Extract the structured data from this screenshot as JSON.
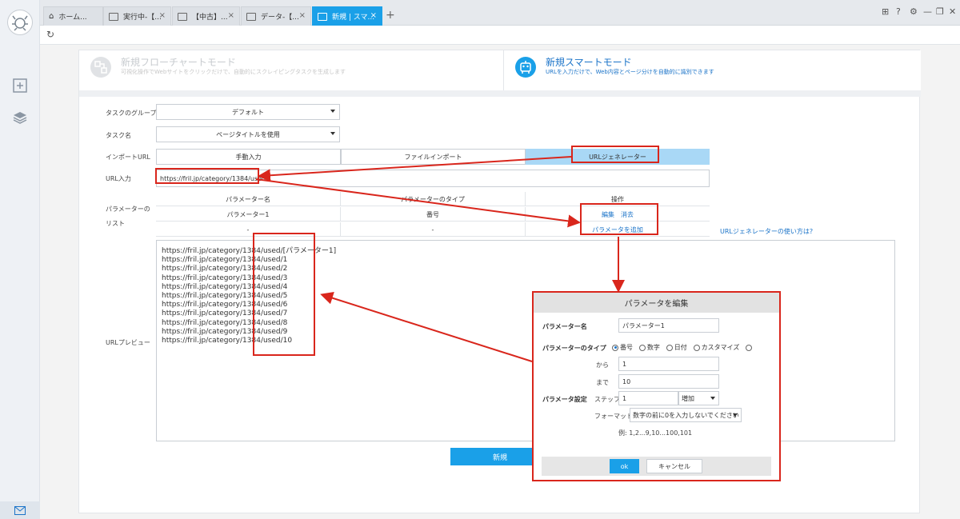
{
  "tabs": [
    {
      "label": "ホーム..."
    },
    {
      "label": "実行中-【..."
    },
    {
      "label": "【中古】..."
    },
    {
      "label": "データ-【..."
    },
    {
      "label": "新規 | スマ..."
    }
  ],
  "modes": {
    "flowchart": {
      "title": "新規フローチャートモード",
      "subtitle": "可視化操作でWebサイトをクリックだけで、自動的にスクレイピングタスクを生成します"
    },
    "smart": {
      "title": "新規スマートモード",
      "subtitle": "URLを入力だけで、Web内容とページ分けを自動的に識別できます"
    }
  },
  "form": {
    "group_label": "タスクのグループ",
    "group_value": "デフォルト",
    "name_label": "タスク名",
    "name_value": "ページタイトルを使用",
    "import_label": "インポートURL",
    "import_tabs": [
      "手動入力",
      "ファイルインポート",
      "URLジェネレーター"
    ],
    "url_label": "URL入力",
    "url_value": "https://fril.jp/category/1384/used/",
    "param_list_label": "パラメーターのリスト",
    "param_headers": [
      "パラメーター名",
      "パラメーターのタイプ",
      "操作"
    ],
    "param_rows": [
      {
        "name": "パラメーター1",
        "type": "番号",
        "edit": "編集",
        "delete": "消去"
      },
      {
        "name": "-",
        "type": "-",
        "add": "パラメータを追加"
      }
    ],
    "help_link": "URLジェネレーターの使い方は?",
    "preview_label": "URLプレビュー",
    "preview_lines": [
      "https://fril.jp/category/1384/used/[パラメーター1]",
      "https://fril.jp/category/1384/used/1",
      "https://fril.jp/category/1384/used/2",
      "https://fril.jp/category/1384/used/3",
      "https://fril.jp/category/1384/used/4",
      "https://fril.jp/category/1384/used/5",
      "https://fril.jp/category/1384/used/6",
      "https://fril.jp/category/1384/used/7",
      "https://fril.jp/category/1384/used/8",
      "https://fril.jp/category/1384/used/9",
      "https://fril.jp/category/1384/used/10"
    ],
    "new_button": "新規"
  },
  "modal": {
    "title": "パラメータを編集",
    "name_label": "パラメーター名",
    "name_value": "パラメーター1",
    "type_label": "パラメーターのタイプ",
    "type_options": [
      "番号",
      "数字",
      "日付",
      "カスタマイズ",
      ""
    ],
    "type_selected": "番号",
    "from_label": "から",
    "from_value": "1",
    "to_label": "まで",
    "to_value": "10",
    "settings_label": "パラメータ設定",
    "step_label": "ステップ",
    "step_value": "1",
    "step_direction": "増加",
    "format_label": "フォーマット",
    "format_value": "数字の前に0を入力しないでください",
    "example": "例: 1,2...9,10...100,101",
    "ok": "ok",
    "cancel": "キャンセル"
  },
  "colors": {
    "accent": "#1aa0e8",
    "annotation": "#d9261c",
    "link": "#1a73c8"
  }
}
